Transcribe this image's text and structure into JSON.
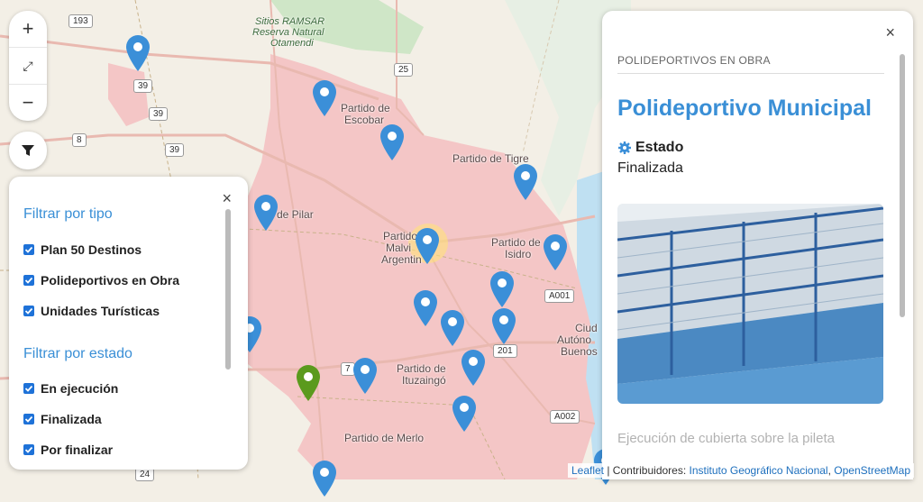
{
  "map": {
    "labels": {
      "sitios_ramsar": "Sitios RAMSAR",
      "reserva": "Reserva Natural",
      "otamendi": "Otamendi",
      "escobar_1": "Partido de",
      "escobar_2": "Escobar",
      "tigre": "Partido de Tigre",
      "pilar": "de Pilar",
      "malvinas_1": "Partido",
      "malvinas_2": "Malvi",
      "malvinas_3": "Argentin",
      "isidro_1": "Partido de",
      "isidro_2": "Isidro",
      "ituzaingo_1": "Partido de",
      "ituzaingo_2": "Ituzaingó",
      "merlo": "Partido de Merlo",
      "ciudad_1": "Ciud",
      "ciudad_2": "Autóno",
      "ciudad_3": "Buenos"
    },
    "shields": {
      "r193": "193",
      "r39a": "39",
      "r39b": "39",
      "r39c": "39",
      "r8": "8",
      "r25": "25",
      "a001": "A001",
      "r201": "201",
      "r7": "7",
      "a002": "A002",
      "r24": "24"
    },
    "colors": {
      "land": "#f3efe6",
      "district": "#f4c6c6",
      "water": "#bfe0f2",
      "green": "#cfe6c7",
      "pin_blue": "#3b8fd8",
      "pin_green": "#5b9a1d",
      "road": "#e9b9b0"
    },
    "zoom_in_label": "+",
    "expand_label": "⤢",
    "zoom_out_label": "−"
  },
  "filter_panel": {
    "close_label": "×",
    "tipo_heading": "Filtrar por tipo",
    "tipo_items": [
      "Plan 50 Destinos",
      "Polideportivos en Obra",
      "Unidades Turísticas"
    ],
    "estado_heading": "Filtrar por estado",
    "estado_items": [
      "En ejecución",
      "Finalizada",
      "Por finalizar"
    ]
  },
  "info_panel": {
    "close_label": "×",
    "category": "POLIDEPORTIVOS EN OBRA",
    "title": "Polideportivo Municipal",
    "estado_label": "Estado",
    "estado_value": "Finalizada",
    "description": "Ejecución de cubierta sobre la pileta"
  },
  "attribution": {
    "leaflet": "Leaflet",
    "sep": " | Contribuidores: ",
    "ign": "Instituto Geográfico Nacional",
    "comma": ", ",
    "osm": "OpenStreetMap"
  }
}
